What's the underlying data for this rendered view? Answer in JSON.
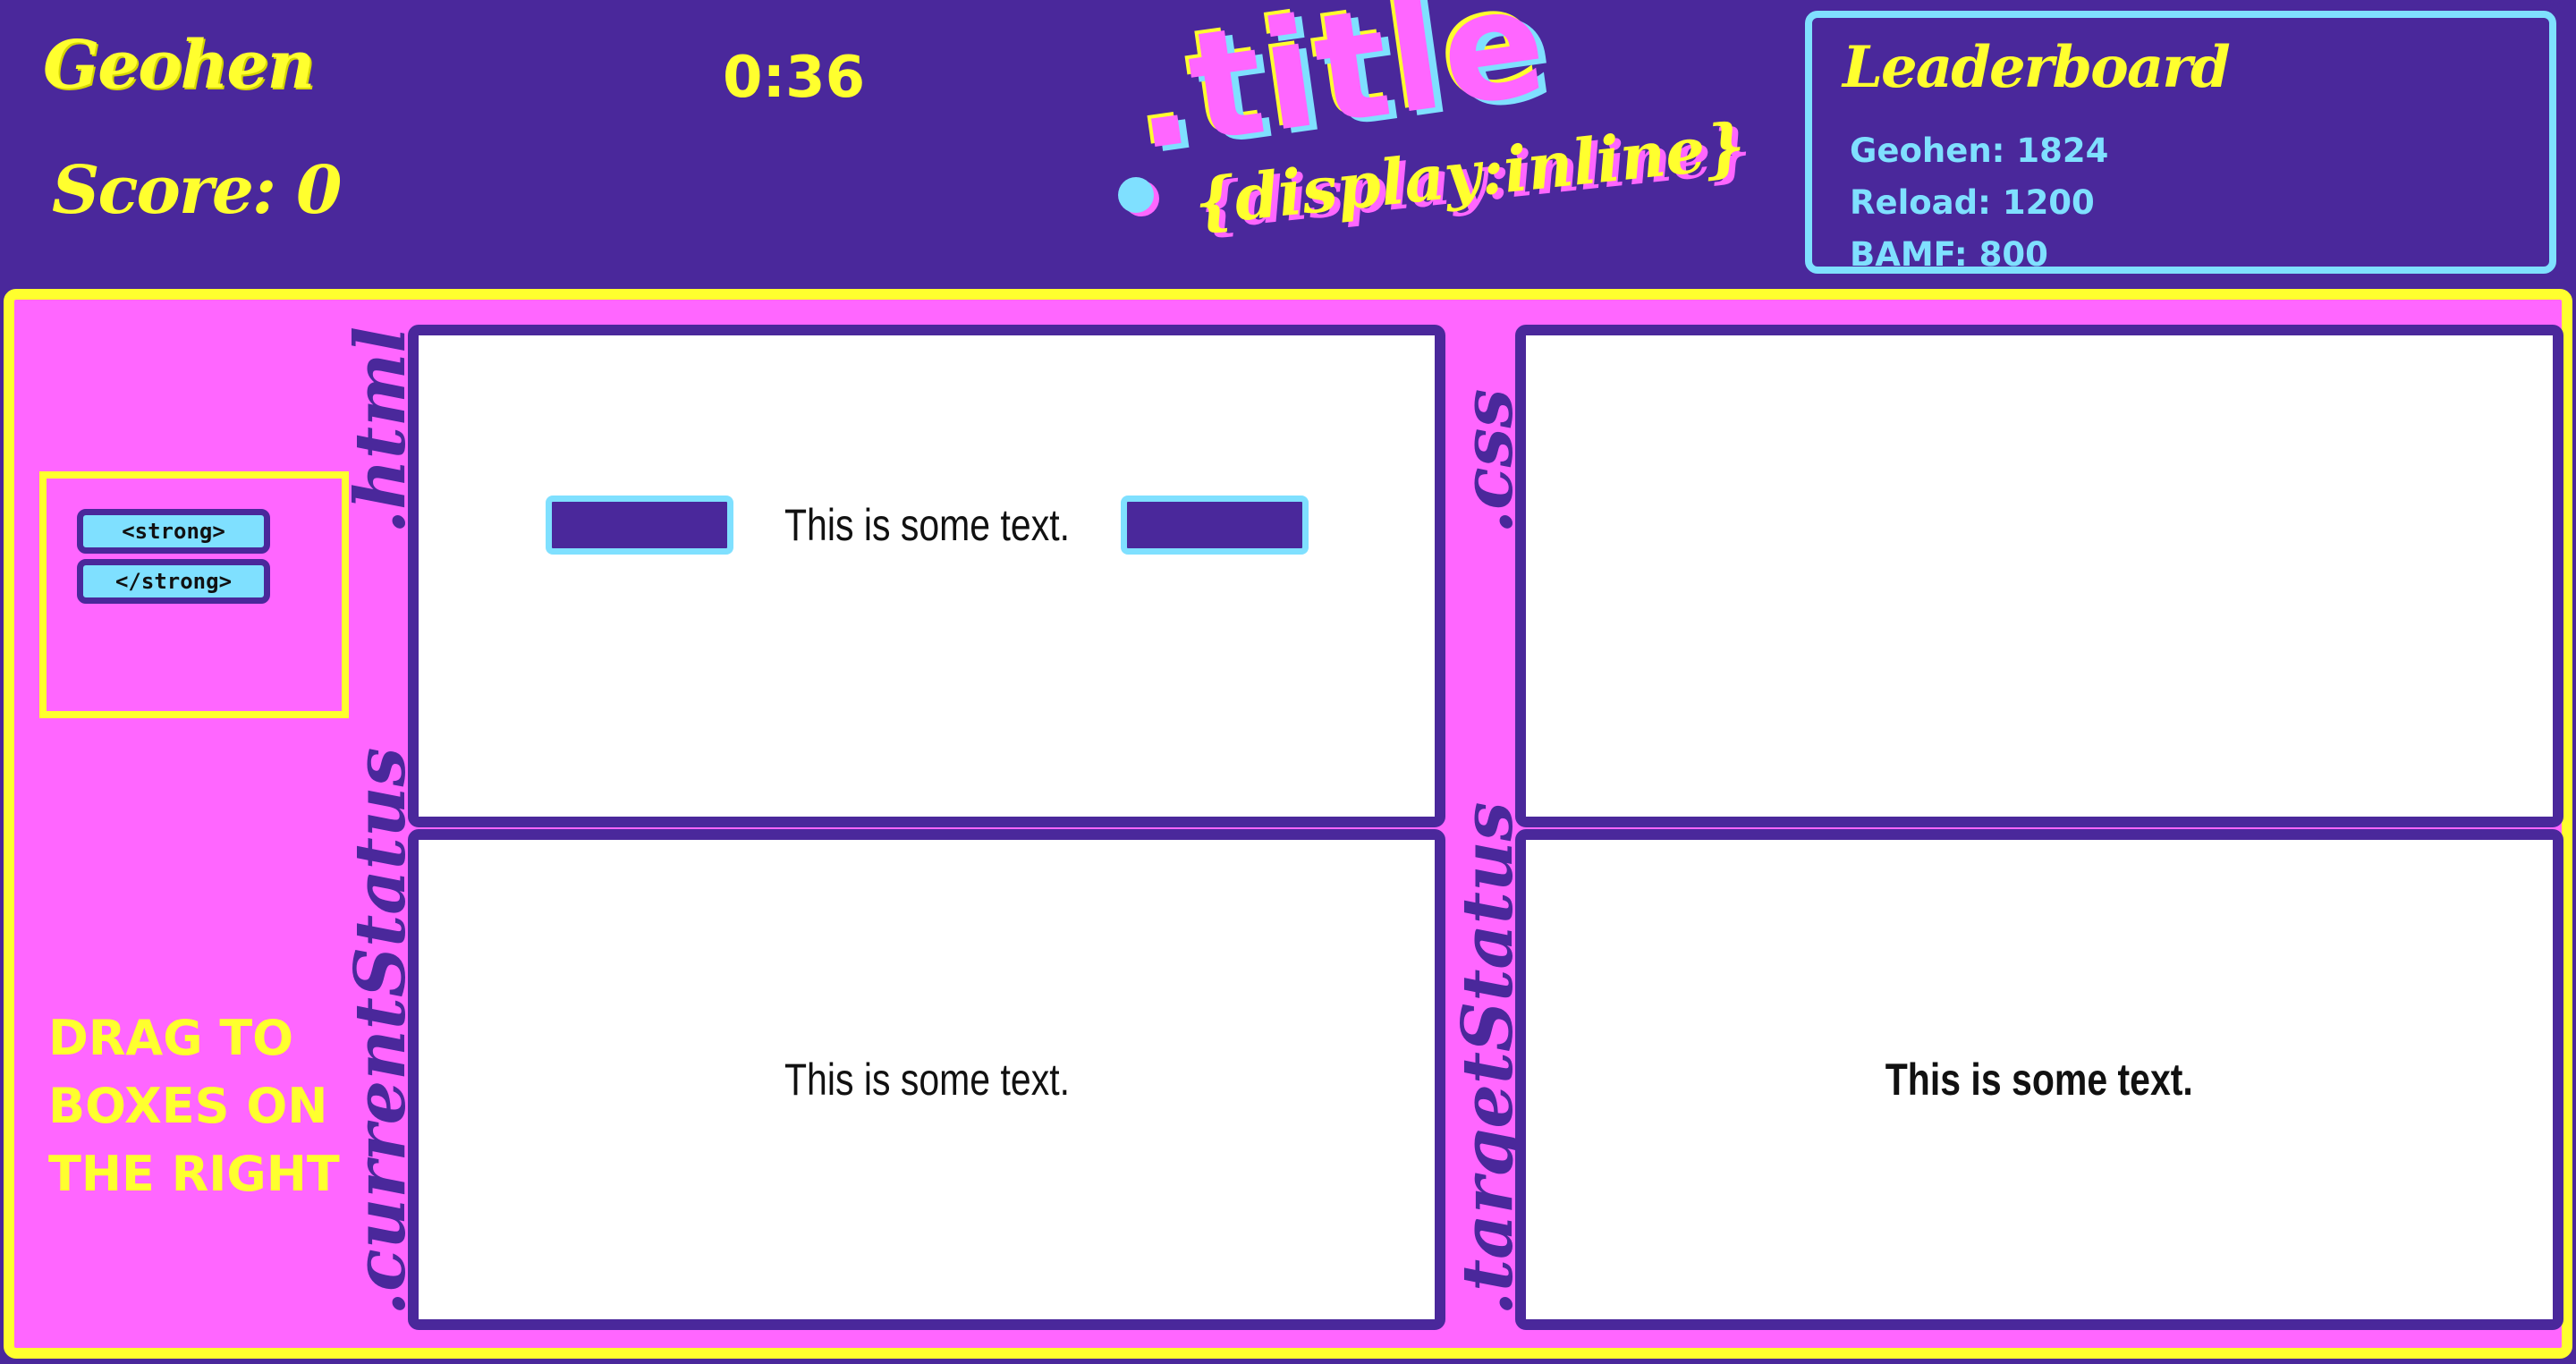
{
  "header": {
    "player_name": "Geohen",
    "score_label": "Score: 0",
    "timer": "0:36"
  },
  "logo": {
    "title": ".title",
    "subtitle": "{display:inline}"
  },
  "leaderboard": {
    "title": "Leaderboard",
    "entries": [
      {
        "text": "Geohen: 1824"
      },
      {
        "text": "Reload: 1200"
      },
      {
        "text": "BAMF: 800"
      }
    ]
  },
  "tag_bank": {
    "chips": [
      {
        "label": "<strong>"
      },
      {
        "label": "</strong>"
      }
    ]
  },
  "instructions": "DRAG TO BOXES ON THE RIGHT",
  "panels": {
    "html": {
      "label": ".html",
      "text": "This is some text."
    },
    "css": {
      "label": ".css"
    },
    "current_status": {
      "label": ".currentStatus",
      "text": "This is some text."
    },
    "target_status": {
      "label": ".targetStatus",
      "text": "This is some text."
    }
  },
  "colors": {
    "background": "#4a289b",
    "accent_yellow": "#ffff2e",
    "accent_pink": "#ff66ff",
    "accent_cyan": "#7fe0ff"
  }
}
